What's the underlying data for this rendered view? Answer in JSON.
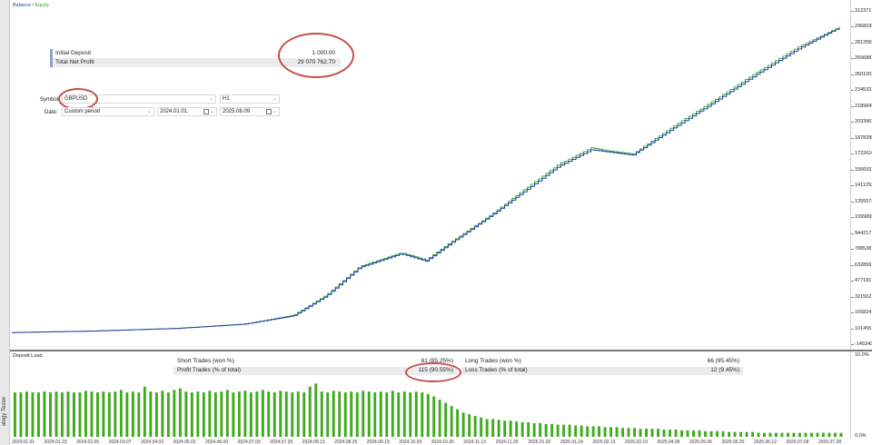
{
  "header": {
    "balance": "Balance",
    "sep": " / ",
    "equity": "Equity"
  },
  "sidebar": {
    "label": "ategy Tester"
  },
  "colors": {
    "balance": "#1a3fa8",
    "equity": "#2e9e2e",
    "accent_oval": "#c0504d",
    "bars": "#3faa1e"
  },
  "summary": {
    "initial_deposit_label": "Initial Deposit",
    "initial_deposit_value": "1 000.00",
    "net_profit_label": "Total Net Profit",
    "net_profit_value": "29 070 762.70"
  },
  "controls": {
    "symbol_label": "Symbol:",
    "symbol_value": "GBPUSD",
    "timeframe_value": "H1",
    "date_label": "Date:",
    "period_value": "Custom period",
    "date_from": "2024.01.01",
    "date_to": "2025.08.09"
  },
  "stats": {
    "short_label": "Short Trades (won %)",
    "short_value": "61 (85.25%)",
    "long_label": "Long Trades (won %)",
    "long_value": "66 (95.45%)",
    "profit_label": "Profit Trades (% of total)",
    "profit_value": "115 (90.55%)",
    "loss_label": "Loss Trades (% of total)",
    "loss_value": "12 (9.45%)"
  },
  "deposit_load": {
    "title": "Deposit Load",
    "y_top": "10.0%",
    "y_bottom": "0.0%"
  },
  "chart_data": {
    "type": "line",
    "y_ticks": [
      "31237174",
      "29680383",
      "28125592",
      "26568801",
      "25012010",
      "23455219",
      "21898428",
      "20341637",
      "18784846",
      "17228055",
      "15671264",
      "14114473",
      "12557682",
      "11000891",
      "9444100",
      "7887309",
      "6330518",
      "4773727",
      "3216936",
      "1660145",
      "103354",
      "-1453437"
    ],
    "y_tick_labels_visible": [
      "3123717",
      "2968038",
      "2812559",
      "2656881",
      "2501002",
      "2345324",
      "2189845",
      "2033967",
      "1878288",
      "1722610",
      "1566931",
      "1411252",
      "1255574",
      "1099895",
      "944217",
      "788538",
      "632859",
      "477181",
      "321502",
      "165824",
      "101455",
      "-145343"
    ],
    "ylim": [
      -1453437,
      31237174
    ],
    "x_labels": [
      "2024.01.01",
      "2024.01.23",
      "2024.02.05",
      "2024.03.07",
      "2024.04.03",
      "2024.05.02",
      "2024.06.03",
      "2024.07.03",
      "2024.07.29",
      "2024.08.13",
      "2024.08.29",
      "2024.09.19",
      "2024.10.03",
      "2024.10.30",
      "2024.11.13",
      "2024.11.25",
      "2025.01.02",
      "2025.01.24",
      "2025.02.13",
      "2025.03.19",
      "2025.04.09",
      "2025.05.06",
      "2025.05.20",
      "2025.06.12",
      "2025.07.08",
      "2025.07.28"
    ],
    "series": [
      {
        "name": "Balance",
        "x": [
          0,
          0.1,
          0.2,
          0.28,
          0.34,
          0.38,
          0.42,
          0.47,
          0.5,
          0.53,
          0.58,
          0.62,
          0.66,
          0.7,
          0.72,
          0.75,
          0.8,
          0.85,
          0.9,
          0.95,
          1.0
        ],
        "y": [
          1000,
          150000,
          400000,
          800000,
          1600000,
          3500000,
          6200000,
          7500000,
          6800000,
          8500000,
          11200000,
          13500000,
          15800000,
          17400000,
          17200000,
          16900000,
          19500000,
          22000000,
          24600000,
          27000000,
          29071762
        ]
      },
      {
        "name": "Equity",
        "x": [
          0,
          0.1,
          0.2,
          0.28,
          0.34,
          0.38,
          0.42,
          0.47,
          0.5,
          0.53,
          0.58,
          0.62,
          0.66,
          0.7,
          0.72,
          0.75,
          0.8,
          0.85,
          0.9,
          0.95,
          1.0
        ],
        "y": [
          1000,
          150000,
          400000,
          800000,
          1650000,
          3600000,
          6300000,
          7600000,
          6900000,
          8600000,
          11300000,
          13700000,
          16000000,
          17600000,
          17300000,
          17000000,
          19700000,
          22200000,
          24800000,
          27200000,
          29100000
        ]
      }
    ],
    "deposit_load_values": [
      0.55,
      0.55,
      0.56,
      0.55,
      0.55,
      0.56,
      0.55,
      0.56,
      0.55,
      0.56,
      0.55,
      0.55,
      0.57,
      0.56,
      0.55,
      0.56,
      0.55,
      0.56,
      0.58,
      0.55,
      0.56,
      0.55,
      0.62,
      0.56,
      0.55,
      0.57,
      0.55,
      0.58,
      0.6,
      0.56,
      0.55,
      0.56,
      0.55,
      0.57,
      0.55,
      0.56,
      0.58,
      0.55,
      0.56,
      0.57,
      0.55,
      0.56,
      0.58,
      0.56,
      0.55,
      0.57,
      0.56,
      0.55,
      0.56,
      0.55,
      0.62,
      0.66,
      0.56,
      0.55,
      0.57,
      0.56,
      0.55,
      0.56,
      0.55,
      0.57,
      0.56,
      0.55,
      0.56,
      0.55,
      0.57,
      0.55,
      0.56,
      0.55,
      0.56,
      0.55,
      0.53,
      0.5,
      0.46,
      0.42,
      0.38,
      0.34,
      0.3,
      0.28,
      0.26,
      0.24,
      0.22,
      0.22,
      0.21,
      0.2,
      0.2,
      0.19,
      0.18,
      0.18,
      0.17,
      0.17,
      0.16,
      0.16,
      0.15,
      0.15,
      0.15,
      0.14,
      0.14,
      0.13,
      0.13,
      0.13,
      0.12,
      0.12,
      0.12,
      0.11,
      0.11,
      0.11,
      0.1,
      0.1,
      0.1,
      0.1,
      0.09,
      0.09,
      0.09,
      0.08,
      0.08,
      0.08,
      0.08,
      0.07,
      0.07,
      0.07,
      0.07,
      0.06,
      0.06,
      0.06,
      0.06,
      0.06,
      0.05,
      0.05,
      0.05,
      0.05,
      0.05,
      0.05,
      0.05,
      0.05,
      0.05,
      0.05,
      0.05,
      0.05,
      0.05,
      0.05,
      0.05
    ]
  }
}
